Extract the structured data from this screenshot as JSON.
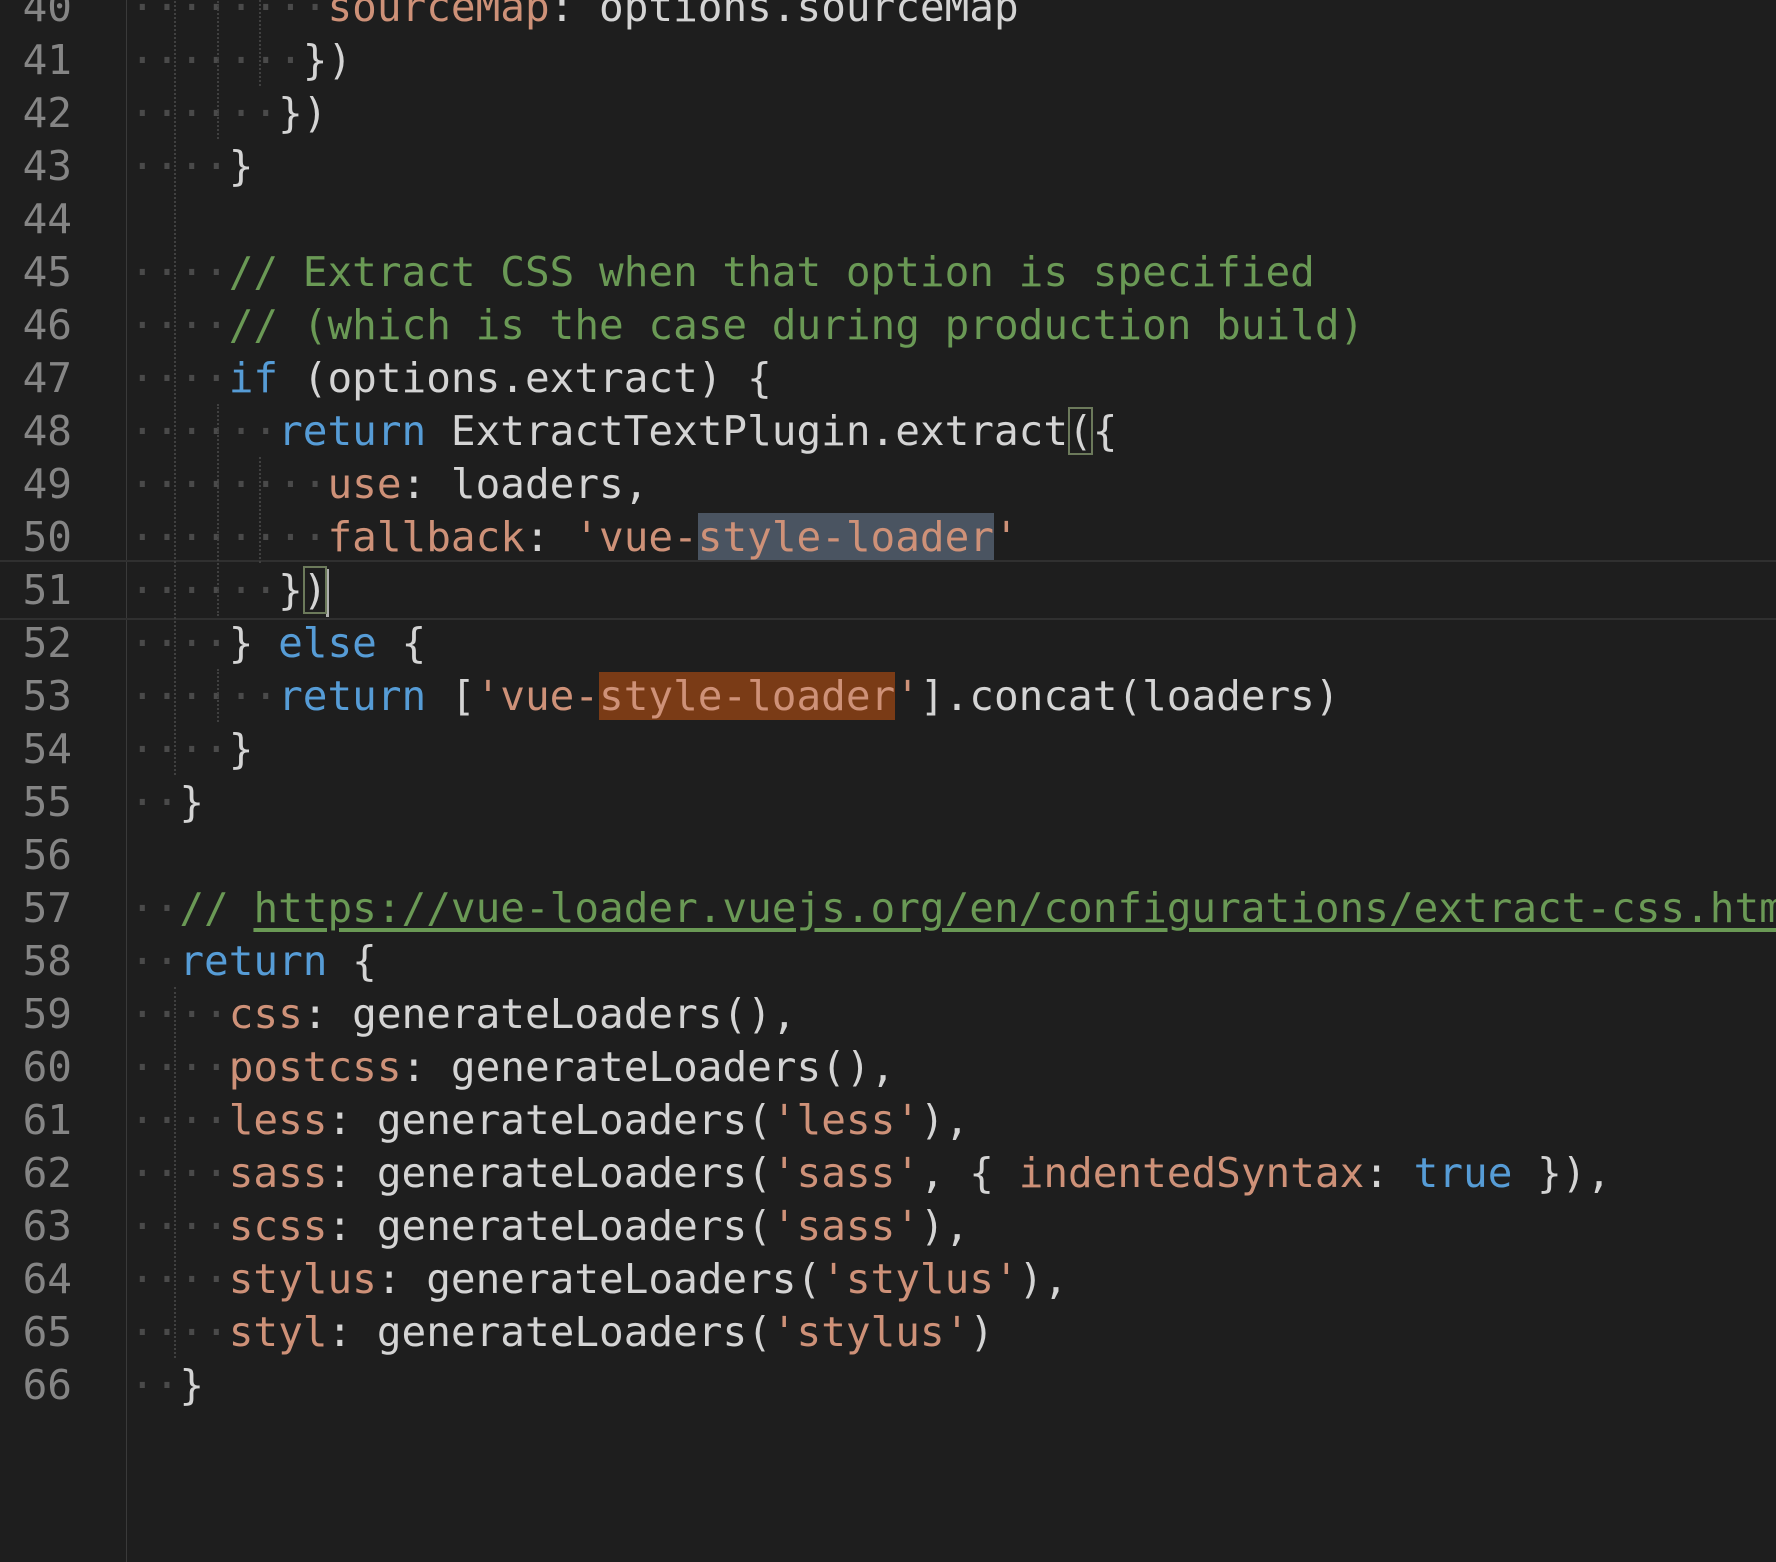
{
  "editor": {
    "language": "javascript",
    "current_line": 51,
    "lines": [
      {
        "n": "40",
        "indent": 8,
        "tokens": [
          {
            "t": "sourceMap",
            "c": "c-prop"
          },
          {
            "t": ": ",
            "c": "c-txt"
          },
          {
            "t": "options.sourceMap",
            "c": "c-txt"
          }
        ]
      },
      {
        "n": "41",
        "indent": 7,
        "tokens": [
          {
            "t": "})",
            "c": "c-txt"
          }
        ]
      },
      {
        "n": "42",
        "indent": 6,
        "tokens": [
          {
            "t": "})",
            "c": "c-txt"
          }
        ]
      },
      {
        "n": "43",
        "indent": 4,
        "tokens": [
          {
            "t": "}",
            "c": "c-txt"
          }
        ]
      },
      {
        "n": "44",
        "indent": 0,
        "tokens": []
      },
      {
        "n": "45",
        "indent": 4,
        "tokens": [
          {
            "t": "// Extract CSS when that option is specified",
            "c": "c-com"
          }
        ]
      },
      {
        "n": "46",
        "indent": 4,
        "tokens": [
          {
            "t": "// (which is the case during production build)",
            "c": "c-com"
          }
        ]
      },
      {
        "n": "47",
        "indent": 4,
        "tokens": [
          {
            "t": "if",
            "c": "c-kw"
          },
          {
            "t": " (options.extract) {",
            "c": "c-txt"
          }
        ]
      },
      {
        "n": "48",
        "indent": 6,
        "tokens": [
          {
            "t": "return",
            "c": "c-kw"
          },
          {
            "t": " ExtractTextPlugin.extract",
            "c": "c-txt"
          },
          {
            "t": "(",
            "c": "c-txt bracket-match"
          },
          {
            "t": "{",
            "c": "c-txt"
          }
        ]
      },
      {
        "n": "49",
        "indent": 8,
        "tokens": [
          {
            "t": "use",
            "c": "c-prop"
          },
          {
            "t": ": loaders,",
            "c": "c-txt"
          }
        ]
      },
      {
        "n": "50",
        "indent": 8,
        "tokens": [
          {
            "t": "fallback",
            "c": "c-prop"
          },
          {
            "t": ": ",
            "c": "c-txt"
          },
          {
            "t": "'vue-",
            "c": "c-str"
          },
          {
            "t": "style-loader",
            "c": "c-str hl-sel"
          },
          {
            "t": "'",
            "c": "c-str"
          }
        ]
      },
      {
        "n": "51",
        "indent": 6,
        "tokens": [
          {
            "t": "}",
            "c": "c-txt"
          },
          {
            "t": ")",
            "c": "c-txt bracket-match"
          }
        ],
        "cursor": true
      },
      {
        "n": "52",
        "indent": 4,
        "tokens": [
          {
            "t": "} ",
            "c": "c-txt"
          },
          {
            "t": "else",
            "c": "c-kw"
          },
          {
            "t": " {",
            "c": "c-txt"
          }
        ]
      },
      {
        "n": "53",
        "indent": 6,
        "tokens": [
          {
            "t": "return",
            "c": "c-kw"
          },
          {
            "t": " [",
            "c": "c-txt"
          },
          {
            "t": "'vue-",
            "c": "c-str"
          },
          {
            "t": "style-loader",
            "c": "c-str hl-find"
          },
          {
            "t": "'",
            "c": "c-str"
          },
          {
            "t": "].concat(loaders)",
            "c": "c-txt"
          }
        ]
      },
      {
        "n": "54",
        "indent": 4,
        "tokens": [
          {
            "t": "}",
            "c": "c-txt"
          }
        ]
      },
      {
        "n": "55",
        "indent": 2,
        "tokens": [
          {
            "t": "}",
            "c": "c-txt"
          }
        ]
      },
      {
        "n": "56",
        "indent": 0,
        "tokens": []
      },
      {
        "n": "57",
        "indent": 2,
        "tokens": [
          {
            "t": "// ",
            "c": "c-com"
          },
          {
            "t": "https://vue-loader.vuejs.org/en/configurations/extract-css.html",
            "c": "c-link"
          }
        ]
      },
      {
        "n": "58",
        "indent": 2,
        "tokens": [
          {
            "t": "return",
            "c": "c-kw"
          },
          {
            "t": " {",
            "c": "c-txt"
          }
        ]
      },
      {
        "n": "59",
        "indent": 4,
        "tokens": [
          {
            "t": "css",
            "c": "c-prop"
          },
          {
            "t": ": generateLoaders(),",
            "c": "c-txt"
          }
        ]
      },
      {
        "n": "60",
        "indent": 4,
        "tokens": [
          {
            "t": "postcss",
            "c": "c-prop"
          },
          {
            "t": ": generateLoaders(),",
            "c": "c-txt"
          }
        ]
      },
      {
        "n": "61",
        "indent": 4,
        "tokens": [
          {
            "t": "less",
            "c": "c-prop"
          },
          {
            "t": ": generateLoaders(",
            "c": "c-txt"
          },
          {
            "t": "'less'",
            "c": "c-str"
          },
          {
            "t": "),",
            "c": "c-txt"
          }
        ]
      },
      {
        "n": "62",
        "indent": 4,
        "tokens": [
          {
            "t": "sass",
            "c": "c-prop"
          },
          {
            "t": ": generateLoaders(",
            "c": "c-txt"
          },
          {
            "t": "'sass'",
            "c": "c-str"
          },
          {
            "t": ", { ",
            "c": "c-txt"
          },
          {
            "t": "indentedSyntax",
            "c": "c-prop"
          },
          {
            "t": ": ",
            "c": "c-txt"
          },
          {
            "t": "true",
            "c": "c-kw"
          },
          {
            "t": " }),",
            "c": "c-txt"
          }
        ]
      },
      {
        "n": "63",
        "indent": 4,
        "tokens": [
          {
            "t": "scss",
            "c": "c-prop"
          },
          {
            "t": ": generateLoaders(",
            "c": "c-txt"
          },
          {
            "t": "'sass'",
            "c": "c-str"
          },
          {
            "t": "),",
            "c": "c-txt"
          }
        ]
      },
      {
        "n": "64",
        "indent": 4,
        "tokens": [
          {
            "t": "stylus",
            "c": "c-prop"
          },
          {
            "t": ": generateLoaders(",
            "c": "c-txt"
          },
          {
            "t": "'stylus'",
            "c": "c-str"
          },
          {
            "t": "),",
            "c": "c-txt"
          }
        ]
      },
      {
        "n": "65",
        "indent": 4,
        "tokens": [
          {
            "t": "styl",
            "c": "c-prop"
          },
          {
            "t": ": generateLoaders(",
            "c": "c-txt"
          },
          {
            "t": "'stylus'",
            "c": "c-str"
          },
          {
            "t": ")",
            "c": "c-txt"
          }
        ]
      },
      {
        "n": "66",
        "indent": 2,
        "tokens": [
          {
            "t": "}",
            "c": "c-txt"
          }
        ]
      }
    ]
  },
  "colors": {
    "background": "#1e1e1e",
    "line_number": "#858585",
    "keyword": "#569cd6",
    "string": "#ce9178",
    "comment": "#6a9955",
    "text": "#d4d4d4",
    "selection_highlight": "#4a5461",
    "find_highlight": "#7a3b16"
  }
}
